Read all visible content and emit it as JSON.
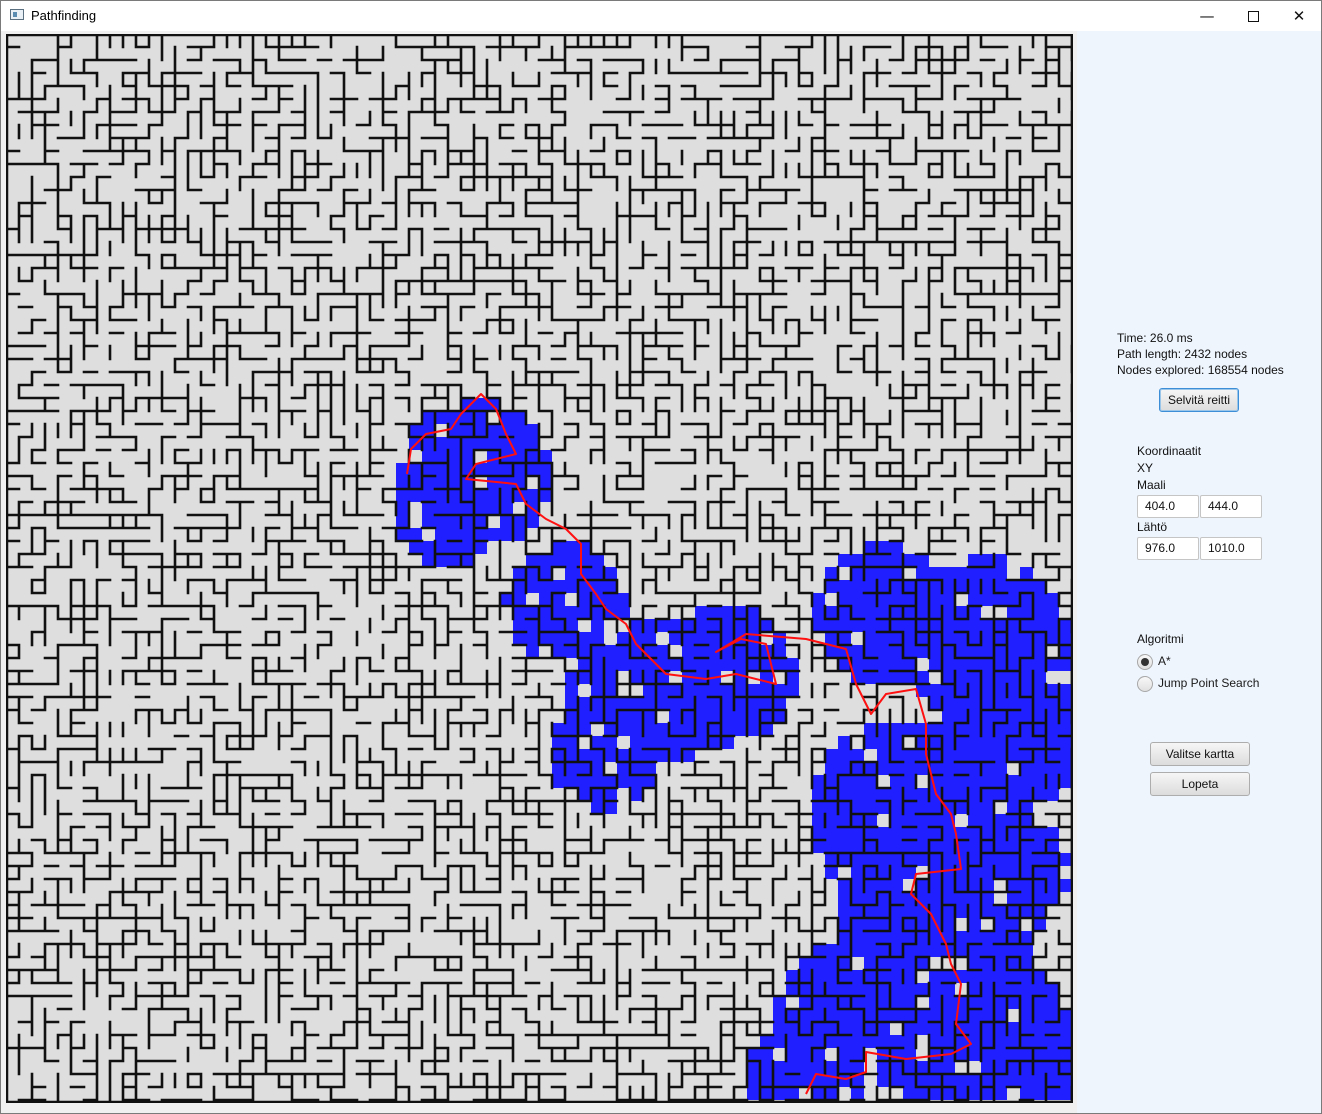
{
  "window": {
    "title": "Pathfinding",
    "controls": {
      "minimize": "—",
      "maximize": "",
      "close": "✕"
    }
  },
  "stats": {
    "time": "Time: 26.0 ms",
    "path_length": "Path length: 2432 nodes",
    "nodes_explored": "Nodes explored: 168554 nodes"
  },
  "solve_button": "Selvitä reitti",
  "coordinates": {
    "heading": "Koordinaatit",
    "xy_label": "XY",
    "goal_label": "Maali",
    "goal_x": "404.0",
    "goal_y": "444.0",
    "start_label": "Lähtö",
    "start_x": "976.0",
    "start_y": "1010.0"
  },
  "algorithm": {
    "heading": "Algoritmi",
    "options": [
      {
        "label": "A*",
        "selected": true
      },
      {
        "label": "Jump Point Search",
        "selected": false
      }
    ]
  },
  "actions": {
    "choose_map": "Valitse kartta",
    "quit": "Lopeta"
  },
  "colors": {
    "wall": "#111111",
    "floor": "#dedede",
    "explored": "#1f1fff",
    "path": "#ff1010",
    "sidebar": "#eef5fd"
  }
}
